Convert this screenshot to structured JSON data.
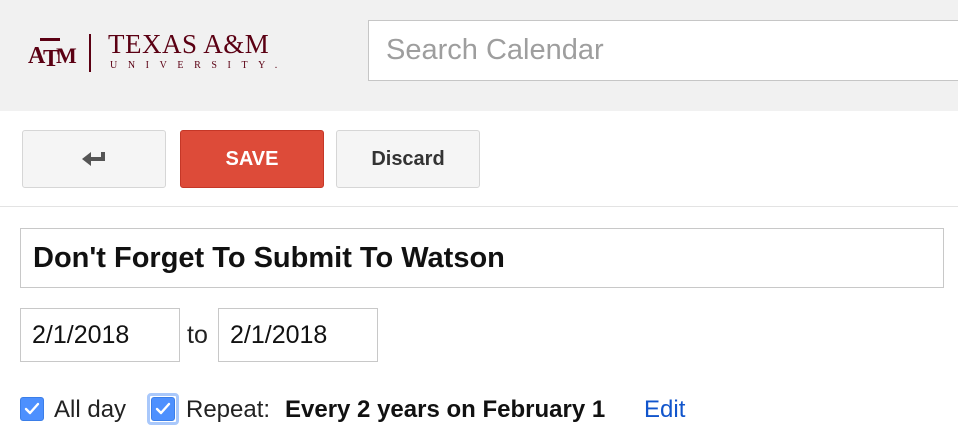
{
  "header": {
    "logo": {
      "mark_text": "ATM",
      "title": "TEXAS A&M",
      "subtitle": "UNIVERSITY."
    },
    "search": {
      "placeholder": "Search Calendar",
      "value": ""
    }
  },
  "toolbar": {
    "back_icon": "back-arrow-icon",
    "save_label": "SAVE",
    "discard_label": "Discard"
  },
  "event": {
    "title": "Don't Forget To Submit To Watson",
    "start_date": "2/1/2018",
    "to_label": "to",
    "end_date": "2/1/2018",
    "all_day": {
      "label": "All day",
      "checked": true
    },
    "repeat": {
      "label": "Repeat:",
      "checked": true,
      "value": "Every 2 years on February 1",
      "edit_label": "Edit"
    }
  },
  "colors": {
    "brand_maroon": "#5b0013",
    "save_red": "#dd4b39",
    "checkbox_blue": "#4d90fe",
    "link_blue": "#1155cc",
    "header_bg": "#f1f1f1"
  }
}
